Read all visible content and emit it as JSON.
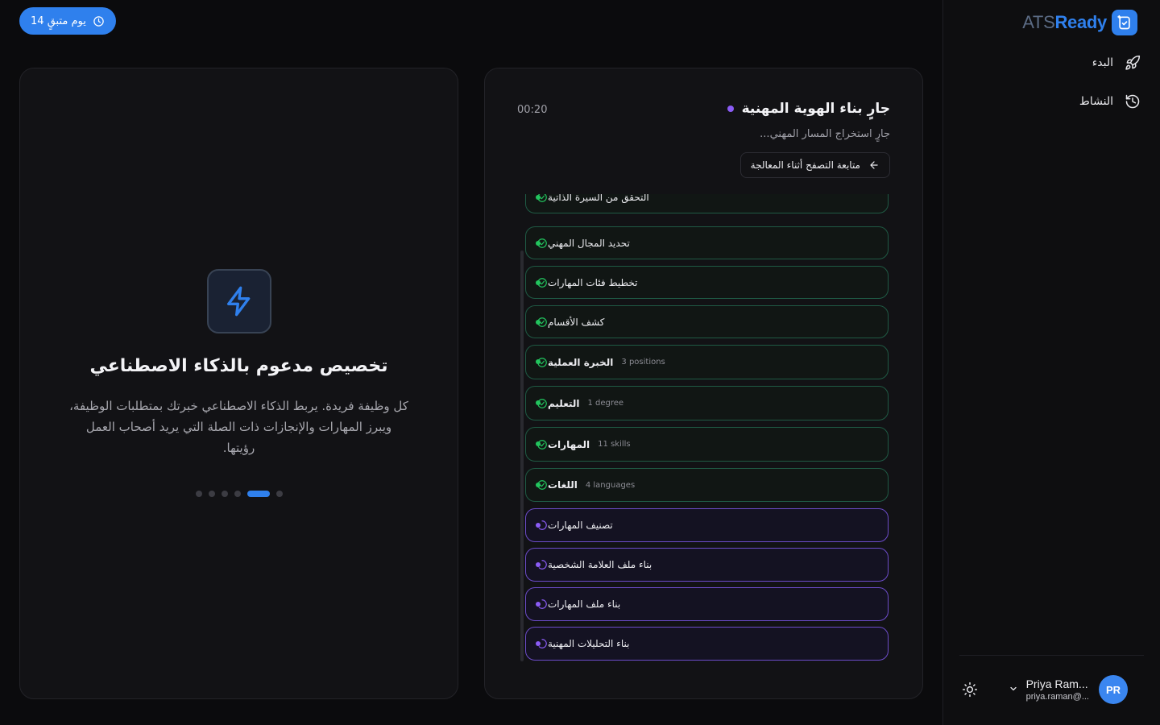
{
  "brand": {
    "name_part1": "ATS",
    "name_part2": "Ready"
  },
  "sidebar": {
    "items": [
      {
        "label": "البدء",
        "icon": "rocket-icon"
      },
      {
        "label": "النشاط",
        "icon": "history-icon"
      }
    ]
  },
  "user": {
    "initials": "PR",
    "name": "Priya Ram...",
    "email": "priya.raman@..."
  },
  "trial": {
    "label": "14 يوم متبقٍ"
  },
  "feature": {
    "title": "تخصيص مدعوم بالذكاء الاصطناعي",
    "description": "كل وظيفة فريدة. يربط الذكاء الاصطناعي خبرتك بمتطلبات الوظيفة، ويبرز المهارات والإنجازات ذات الصلة التي يريد أصحاب العمل رؤيتها.",
    "carousel": {
      "total": 6,
      "active_index": 4
    }
  },
  "processing": {
    "title": "جارٍ بناء الهوية المهنية",
    "subtitle": "جارٍ استخراج المسار المهني...",
    "timer": "00:20",
    "browse_label": "متابعة التصفح أثناء المعالجة",
    "steps": [
      {
        "label": "التحقق من السيرة الذاتية",
        "meta": "",
        "status": "done",
        "bold": false
      },
      {
        "label": "تحديد المجال المهني",
        "meta": "",
        "status": "done",
        "bold": false
      },
      {
        "label": "تخطيط فئات المهارات",
        "meta": "",
        "status": "done",
        "bold": false
      },
      {
        "label": "كشف الأقسام",
        "meta": "",
        "status": "done",
        "bold": false
      },
      {
        "label": "الخبرة العملية",
        "meta": "3 positions",
        "status": "done",
        "bold": true
      },
      {
        "label": "التعليم",
        "meta": "1 degree",
        "status": "done",
        "bold": true
      },
      {
        "label": "المهارات",
        "meta": "11 skills",
        "status": "done",
        "bold": true
      },
      {
        "label": "اللغات",
        "meta": "4 languages",
        "status": "done",
        "bold": true
      },
      {
        "label": "تصنيف المهارات",
        "meta": "",
        "status": "in-progress",
        "bold": false
      },
      {
        "label": "بناء ملف العلامة الشخصية",
        "meta": "",
        "status": "in-progress",
        "bold": false
      },
      {
        "label": "بناء ملف المهارات",
        "meta": "",
        "status": "in-progress",
        "bold": false
      },
      {
        "label": "بناء التحليلات المهنية",
        "meta": "",
        "status": "in-progress",
        "bold": false
      }
    ]
  },
  "colors": {
    "accent": "#2f80ed",
    "done": "#22c55e",
    "pending": "#8b5cf6"
  }
}
